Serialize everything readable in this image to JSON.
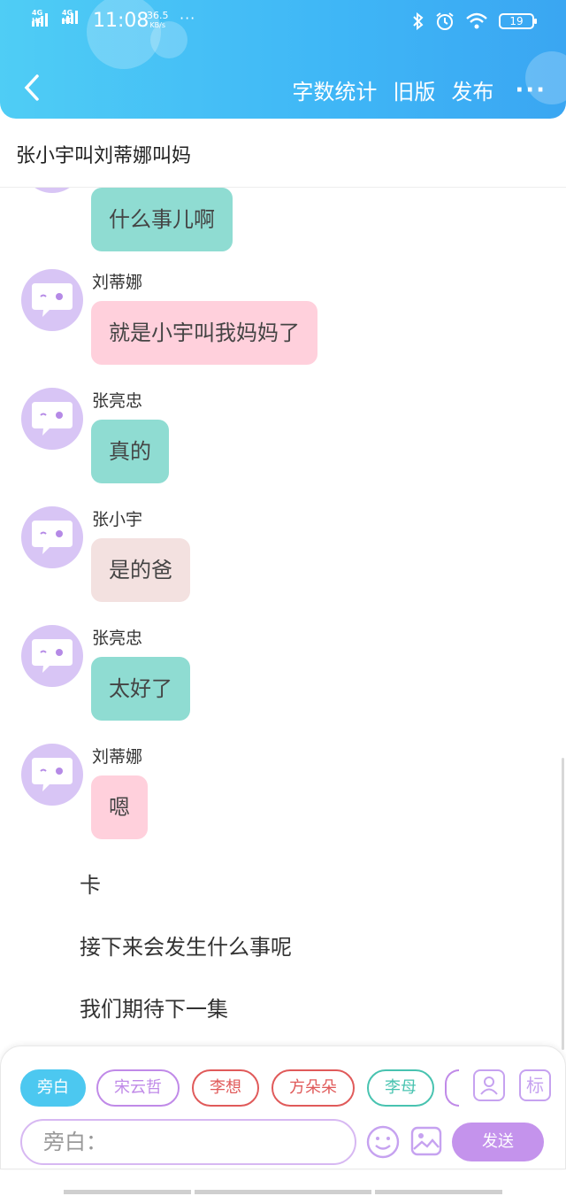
{
  "status_bar": {
    "sim1": "4G HD",
    "sim2": "4G HD",
    "time": "11:08",
    "speed_value": "36.5",
    "speed_unit": "KB/s",
    "overflow_dots": "···",
    "battery": "19"
  },
  "nav": {
    "back_icon": "chevron-left-icon",
    "word_count": "字数统计",
    "old_version": "旧版",
    "publish": "发布",
    "more": "···"
  },
  "story_title": "张小宇叫刘蒂娜叫妈",
  "messages": [
    {
      "sender": "",
      "text": "什么事儿啊",
      "color": "#8fdcd2"
    },
    {
      "sender": "刘蒂娜",
      "text": "就是小宇叫我妈妈了",
      "color": "#ffd0dc"
    },
    {
      "sender": "张亮忠",
      "text": "真的",
      "color": "#8fdcd2"
    },
    {
      "sender": "张小宇",
      "text": "是的爸",
      "color": "#f3e1e0"
    },
    {
      "sender": "张亮忠",
      "text": "太好了",
      "color": "#8fdcd2"
    },
    {
      "sender": "刘蒂娜",
      "text": "嗯",
      "color": "#ffd0dc"
    }
  ],
  "narration": [
    "卡",
    "接下来会发生什么事呢",
    "我们期待下一集"
  ],
  "roles": [
    {
      "label": "旁白",
      "color": "#4cc8f0",
      "active": true
    },
    {
      "label": "宋云哲",
      "color": "#c08ae8"
    },
    {
      "label": "李想",
      "color": "#e05a5a"
    },
    {
      "label": "方朵朵",
      "color": "#e05a5a"
    },
    {
      "label": "李母",
      "color": "#48c3b0"
    }
  ],
  "toolbar": {
    "role_manage_icon": "person-card-icon",
    "mark_label": "标",
    "input_placeholder": "旁白：",
    "emoji_icon": "smiley-icon",
    "image_icon": "image-icon",
    "send_label": "发送"
  }
}
